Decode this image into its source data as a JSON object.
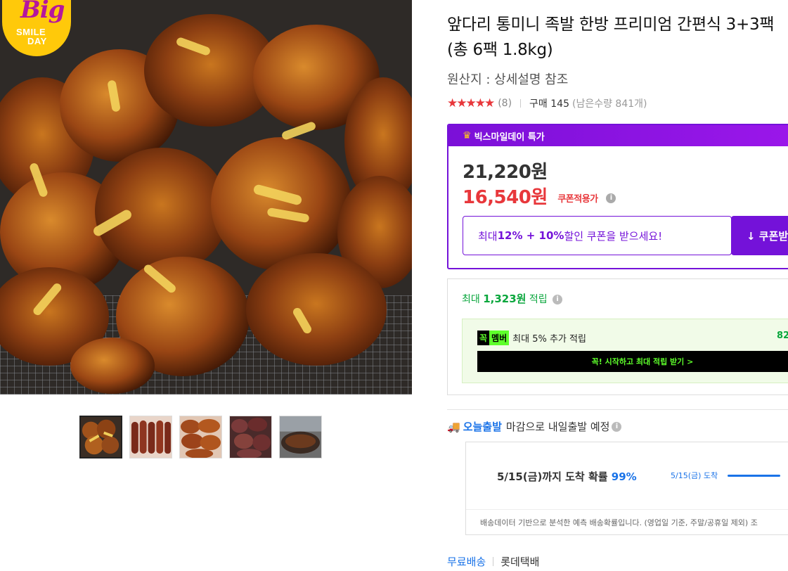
{
  "gallery": {
    "main_alt": "족발",
    "badge": {
      "big": "Big",
      "smile": "SMILE",
      "day": "DAY"
    },
    "thumbnails": [
      "thumb-1",
      "thumb-2",
      "thumb-3",
      "thumb-4",
      "thumb-5"
    ]
  },
  "product": {
    "title": "앞다리 통미니 족발 한방 프리미엄 간편식 3+3팩 (총 6팩 1.8kg)",
    "origin": "원산지 : 상세설명 참조",
    "stars": "★★★★★",
    "review_count": "(8)",
    "purchase": "구매 145",
    "stock": "(남은수량 841개)"
  },
  "deal": {
    "header": "빅스마일데이 특가",
    "original_price": "21,220원",
    "sale_price": "16,540원",
    "coupon_applied": "쿠폰적용가",
    "coupon_prefix": "최대 ",
    "coupon_bold": "12% + 10%",
    "coupon_suffix": " 할인 쿠폰을 받으세요!",
    "coupon_button": "↓ 쿠폰받"
  },
  "reward": {
    "prefix": "최대 ",
    "amount": "1,323원",
    "suffix": " 적립",
    "kkok": "꼭",
    "member": "멤버",
    "member_text": "최대 5% 추가 적립",
    "member_amount": "82",
    "member_button": "꼭! 시작하고 최대 적립 받기 >"
  },
  "shipping": {
    "today_label": "오늘출발",
    "note": "마감으로 내일출발 예정",
    "eta_main": "5/15(금)까지 도착 확률 ",
    "eta_pct": "99%",
    "eta_side": "5/15(금) 도착",
    "eta_progress": 0.99,
    "eta_foot": "배송데이터 기반으로 분석한 예측 배송확률입니다. (영업일 기준, 주말/공휴일 제외) 조",
    "free": "무료배송",
    "carrier": "롯데택배"
  },
  "colors": {
    "purple": "#7412d9",
    "red": "#e8373b",
    "green": "#09a63c",
    "blue": "#1a73e8",
    "neon": "#5eff2b"
  }
}
